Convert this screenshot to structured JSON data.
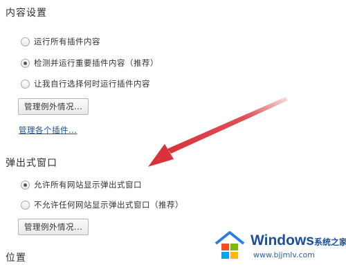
{
  "content_settings": {
    "title": "内容设置",
    "plugins": {
      "options": [
        {
          "label": "运行所有插件内容",
          "checked": false
        },
        {
          "label": "检测并运行重要插件内容（推荐）",
          "checked": true
        },
        {
          "label": "让我自行选择何时运行插件内容",
          "checked": false
        }
      ],
      "manage_exceptions_label": "管理例外情况...",
      "manage_plugins_link": "管理各个插件..."
    },
    "popups": {
      "title": "弹出式窗口",
      "options": [
        {
          "label": "允许所有网站显示弹出式窗口",
          "checked": true
        },
        {
          "label": "不允许任何网站显示弹出式窗口（推荐）",
          "checked": false
        }
      ],
      "manage_exceptions_label": "管理例外情况..."
    },
    "location": {
      "title": "位置"
    }
  },
  "annotation": {
    "arrow_color": "#d8323a"
  },
  "watermark": {
    "brand": "Windows",
    "brand_cn": "系统之家",
    "url": "www.bjjmlv.com"
  }
}
